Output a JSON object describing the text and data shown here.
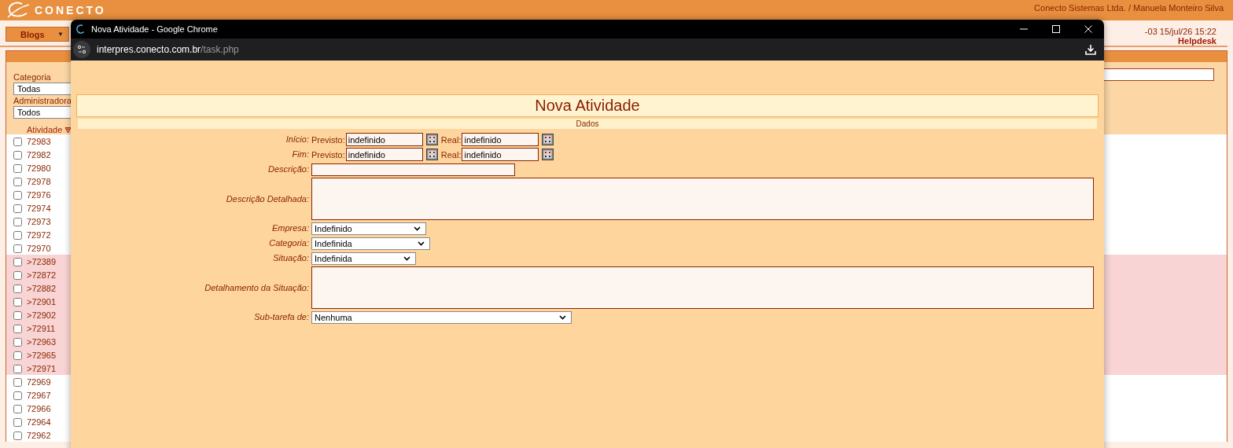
{
  "app_header": {
    "logo": "CONECTO",
    "user": "Conecto Sistemas Ltda. / Manuela Monteiro Silva"
  },
  "menu": {
    "label": "Blogs",
    "caret": "▼"
  },
  "datetime": "-03 15/jul/26 15:22",
  "section": "Helpdesk",
  "filters": [
    {
      "label": "Categoria",
      "value": "Todas"
    },
    {
      "label": "Administradora",
      "value": "Todos"
    }
  ],
  "list": {
    "column": "Atividade",
    "rows": [
      {
        "id": "72983",
        "checked": false,
        "highlighted": false
      },
      {
        "id": "72982",
        "checked": false,
        "highlighted": false
      },
      {
        "id": "72980",
        "checked": false,
        "highlighted": false
      },
      {
        "id": "72978",
        "checked": false,
        "highlighted": false
      },
      {
        "id": "72976",
        "checked": false,
        "highlighted": false
      },
      {
        "id": "72974",
        "checked": false,
        "highlighted": false
      },
      {
        "id": "72973",
        "checked": false,
        "highlighted": false
      },
      {
        "id": "72972",
        "checked": false,
        "highlighted": false
      },
      {
        "id": "72970",
        "checked": false,
        "highlighted": false
      },
      {
        "id": ">72389",
        "checked": false,
        "highlighted": true
      },
      {
        "id": ">72872",
        "checked": false,
        "highlighted": true
      },
      {
        "id": ">72882",
        "checked": false,
        "highlighted": true
      },
      {
        "id": ">72901",
        "checked": false,
        "highlighted": true
      },
      {
        "id": ">72902",
        "checked": false,
        "highlighted": true
      },
      {
        "id": ">72911",
        "checked": false,
        "highlighted": true
      },
      {
        "id": ">72963",
        "checked": false,
        "highlighted": true
      },
      {
        "id": ">72965",
        "checked": false,
        "highlighted": true
      },
      {
        "id": ">72971",
        "checked": false,
        "highlighted": true
      },
      {
        "id": "72969",
        "checked": false,
        "highlighted": false
      },
      {
        "id": "72967",
        "checked": false,
        "highlighted": false
      },
      {
        "id": "72966",
        "checked": false,
        "highlighted": false
      },
      {
        "id": "72964",
        "checked": false,
        "highlighted": false
      },
      {
        "id": "72962",
        "checked": false,
        "highlighted": false
      }
    ]
  },
  "popup": {
    "title": "Nova Atividade - Google Chrome",
    "url": {
      "host": "interpres.conecto.com.br",
      "path": "/task.php"
    },
    "heading": "Nova Atividade",
    "section": "Dados",
    "fields": [
      {
        "kind": "dates",
        "label": "Início:",
        "parts": [
          {
            "label": "Previsto:",
            "value": "indefinido"
          },
          {
            "label": "Real:",
            "value": "indefinido"
          }
        ]
      },
      {
        "kind": "dates",
        "label": "Fim:",
        "parts": [
          {
            "label": "Previsto:",
            "value": "indefinido"
          },
          {
            "label": "Real:",
            "value": "indefinido"
          }
        ]
      },
      {
        "kind": "text",
        "label": "Descrição:"
      },
      {
        "kind": "textarea",
        "label": "Descrição Detalhada:"
      },
      {
        "kind": "select",
        "label": "Empresa:",
        "value": "Indefinido"
      },
      {
        "kind": "select",
        "label": "Categoria:",
        "value": "Indefinida"
      },
      {
        "kind": "select",
        "label": "Situação:",
        "value": "Indefinida"
      },
      {
        "kind": "textarea",
        "label": "Detalhamento da Situação:"
      },
      {
        "kind": "select",
        "label": "Sub-tarefa de:",
        "value": "Nenhuma"
      }
    ]
  }
}
